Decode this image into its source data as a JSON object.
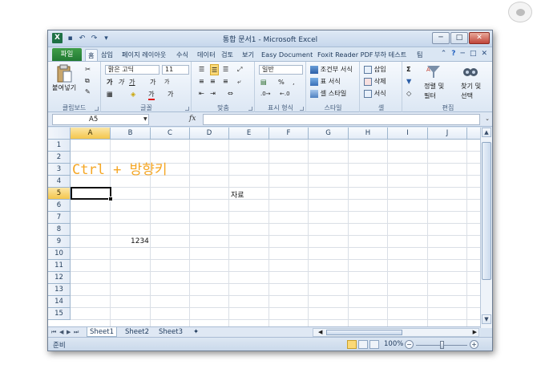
{
  "corner_logo": "bear-logo",
  "window": {
    "title": "통합 문서1 - Microsoft Excel",
    "app_icon": "X",
    "qat_icons": [
      "save-icon",
      "undo-icon",
      "redo-icon",
      "customize-icon"
    ],
    "controls": {
      "minimize": "─",
      "maximize": "□",
      "close": "✕"
    }
  },
  "tabs": {
    "file": "파일",
    "items": [
      "홈",
      "삽입",
      "페이지 레이아웃",
      "수식",
      "데이터",
      "검토",
      "보기",
      "Easy Document C",
      "Foxit Reader PDF",
      "부하 테스트",
      "팀"
    ],
    "right_icons": [
      "⌃",
      "?",
      "─",
      "□",
      "✕"
    ]
  },
  "ribbon": {
    "clipboard": {
      "paste": "붙여넣기",
      "label": "클립보드"
    },
    "font": {
      "name": "맑은 고딕",
      "size": "11",
      "bold": "가",
      "italic": "가",
      "underline": "가",
      "grow": "가",
      "shrink": "가",
      "color_a": "가",
      "label": "글꼴"
    },
    "align": {
      "label": "맞춤"
    },
    "number": {
      "format": "일반",
      "percent": "%",
      "comma": ",",
      "label": "표시 형식"
    },
    "styles": {
      "cond": "조건부 서식",
      "table": "표 서식",
      "cell": "셀 스타일",
      "label": "스타일"
    },
    "cells": {
      "insert": "삽입",
      "delete": "삭제",
      "format": "서식",
      "label": "셀"
    },
    "edit": {
      "sigma": "Σ",
      "sort": "정렬 및",
      "sort2": "필터",
      "find": "찾기 및",
      "find2": "선택",
      "label": "편집"
    }
  },
  "formula_bar": {
    "name_box": "A5",
    "fx": "fx",
    "value": ""
  },
  "sheet": {
    "columns": [
      "A",
      "B",
      "C",
      "D",
      "E",
      "F",
      "G",
      "H",
      "I",
      "J"
    ],
    "rows": [
      "1",
      "2",
      "3",
      "4",
      "5",
      "6",
      "7",
      "8",
      "9",
      "10",
      "11",
      "12",
      "13",
      "14",
      "15"
    ],
    "selected_cell": "A5",
    "cells": {
      "E5": "자료",
      "B9": "1234"
    },
    "overlay_text": "Ctrl + 방향키"
  },
  "sheet_tabs": [
    "Sheet1",
    "Sheet2",
    "Sheet3"
  ],
  "status": {
    "ready": "준비",
    "zoom": "100%",
    "minus": "−",
    "plus": "+"
  },
  "colors": {
    "accent": "#f5a623",
    "file_tab": "#217a33",
    "selected_header": "#f4c64c"
  }
}
